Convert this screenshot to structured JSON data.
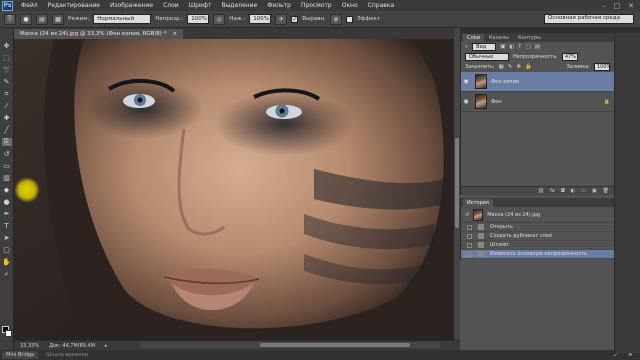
{
  "app": {
    "logo": "Ps",
    "menu": [
      "Файл",
      "Редактирование",
      "Изображение",
      "Слои",
      "Шрифт",
      "Выделение",
      "Фильтр",
      "Просмотр",
      "Окно",
      "Справка"
    ],
    "window_controls": [
      "–",
      "□",
      "✕"
    ],
    "workspace": "Основная рабочая среда"
  },
  "options": {
    "mode_label": "Режим:",
    "mode_value": "Нормальный",
    "opacity_label": "Непрозр.:",
    "opacity_value": "100%",
    "press_label": "Наж.:",
    "press_value": "100%",
    "align_label": "Выравн.",
    "effect_label": "Эффект"
  },
  "document": {
    "tab_title": "Маска (24 из 24).jpg @ 33,3% (Фон копия, RGB/8) *",
    "close": "×"
  },
  "status": {
    "zoom": "33,33%",
    "doc_size": "Док: 44,7M/89,4M"
  },
  "bottom_tabs": [
    "Mini Bridge",
    "Шкала времени"
  ],
  "layers": {
    "tabs": [
      "Слои",
      "Каналы",
      "Контуры"
    ],
    "filter_label": "Вид",
    "blend": "Обычные",
    "opacity_label": "Непрозрачность:",
    "opacity_value": "47%",
    "lock_label": "Закрепить:",
    "fill_label": "Заливка:",
    "fill_value": "100%",
    "items": [
      {
        "name": "Фон копия",
        "selected": true
      },
      {
        "name": "Фон",
        "selected": false,
        "locked": true
      }
    ]
  },
  "history": {
    "tab": "История",
    "snapshot": "Маска (24 из 24).jpg",
    "items": [
      {
        "label": "Открыть",
        "selected": false
      },
      {
        "label": "Создать дубликат слоя",
        "selected": false
      },
      {
        "label": "Штамп",
        "selected": false
      },
      {
        "label": "Изменить основную непрозрачность",
        "selected": true
      }
    ]
  },
  "colors": {
    "selection": "#6a7ea5",
    "cursor": "#f0dc00"
  }
}
